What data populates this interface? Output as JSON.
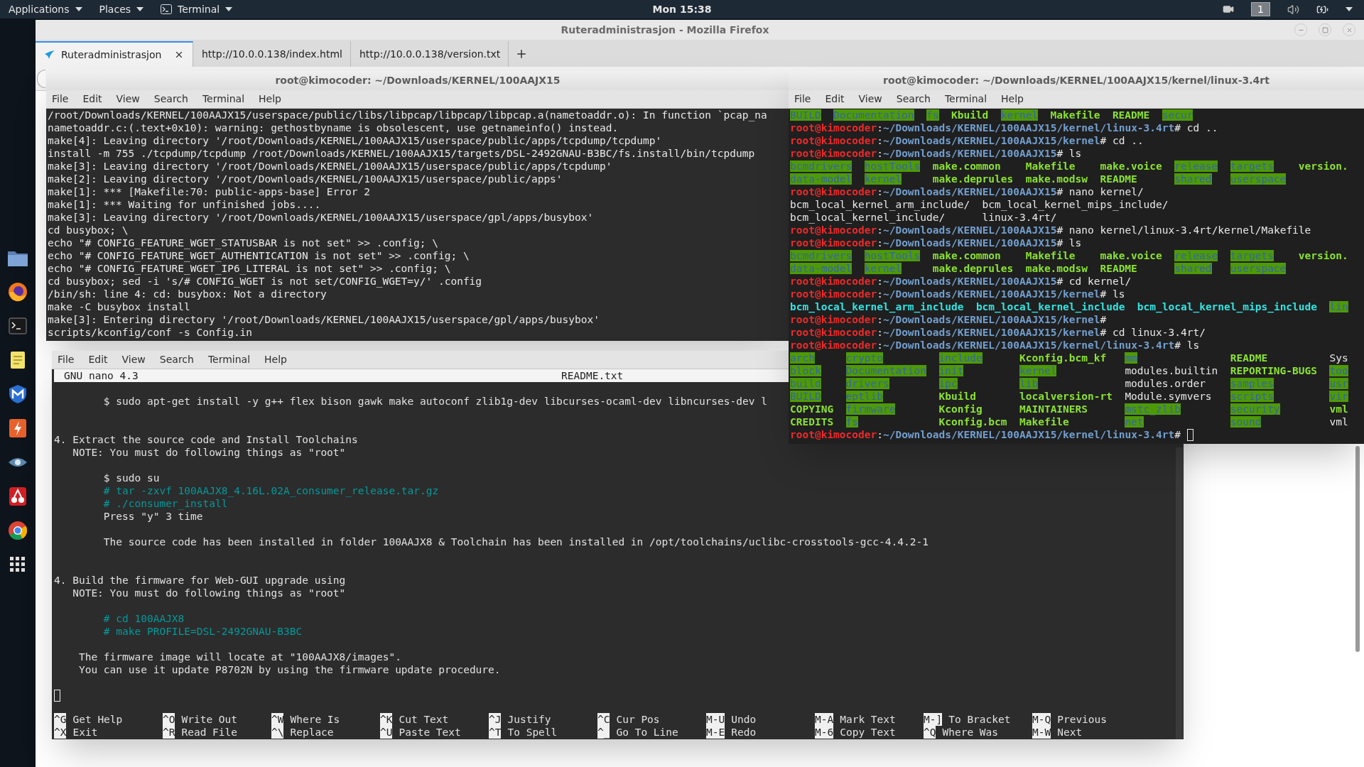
{
  "top_bar": {
    "menus": [
      {
        "label": "Applications",
        "kind": "menu"
      },
      {
        "label": "Places",
        "kind": "menu"
      },
      {
        "label": "Terminal",
        "kind": "app"
      }
    ],
    "clock": "Mon 15:38",
    "workspace": "1"
  },
  "browser": {
    "title": "Ruteradministrasjon - Mozilla Firefox",
    "tabs": [
      {
        "label": "Ruteradministrasjon",
        "selected": true
      },
      {
        "label": "http://10.0.0.138/index.html",
        "selected": false
      },
      {
        "label": "http://10.0.0.138/version.txt",
        "selected": false
      }
    ]
  },
  "terminal_left": {
    "title": "root@kimocoder: ~/Downloads/KERNEL/100AAJX15",
    "menu": [
      "File",
      "Edit",
      "View",
      "Search",
      "Terminal",
      "Help"
    ],
    "lines": [
      "/root/Downloads/KERNEL/100AAJX15/userspace/public/libs/libpcap/libpcap/libpcap.a(nametoaddr.o): In function `pcap_na",
      "nametoaddr.c:(.text+0x10): warning: gethostbyname is obsolescent, use getnameinfo() instead.",
      "make[4]: Leaving directory '/root/Downloads/KERNEL/100AAJX15/userspace/public/apps/tcpdump/tcpdump'",
      "install -m 755 ./tcpdump/tcpdump /root/Downloads/KERNEL/100AAJX15/targets/DSL-2492GNAU-B3BC/fs.install/bin/tcpdump",
      "make[3]: Leaving directory '/root/Downloads/KERNEL/100AAJX15/userspace/public/apps/tcpdump'",
      "make[2]: Leaving directory '/root/Downloads/KERNEL/100AAJX15/userspace/public/apps'",
      "make[1]: *** [Makefile:70: public-apps-base] Error 2",
      "make[1]: *** Waiting for unfinished jobs....",
      "make[3]: Leaving directory '/root/Downloads/KERNEL/100AAJX15/userspace/gpl/apps/busybox'",
      "cd busybox; \\",
      "echo \"# CONFIG_FEATURE_WGET_STATUSBAR is not set\" >> .config; \\",
      "echo \"# CONFIG_FEATURE_WGET_AUTHENTICATION is not set\" >> .config; \\",
      "echo \"# CONFIG_FEATURE_WGET_IP6_LITERAL is not set\" >> .config; \\",
      "cd busybox; sed -i 's/# CONFIG_WGET is not set/CONFIG_WGET=y/' .config",
      "/bin/sh: line 4: cd: busybox: Not a directory",
      "make -C busybox install",
      "make[3]: Entering directory '/root/Downloads/KERNEL/100AAJX15/userspace/gpl/apps/busybox'",
      "scripts/kconfig/conf -s Config.in"
    ]
  },
  "terminal_right": {
    "title": "root@kimocoder: ~/Downloads/KERNEL/100AAJX15/kernel/linux-3.4rt",
    "menu": [
      "File",
      "Edit",
      "View",
      "Search",
      "Terminal",
      "Help"
    ],
    "lines": [
      {
        "kind": "listing",
        "rows": [
          [
            {
              "name": "BUILD",
              "kind": "dir"
            },
            {
              "name": "Documentation",
              "kind": "dir"
            },
            {
              "name": "fs",
              "kind": "dir"
            },
            {
              "name": "Kbuild",
              "kind": "exec"
            },
            {
              "name": "kernel",
              "kind": "dir"
            },
            {
              "name": "Makefile",
              "kind": "exec"
            },
            {
              "name": "README",
              "kind": "exec"
            },
            {
              "name": "secur",
              "kind": "dir"
            }
          ]
        ]
      },
      {
        "kind": "prompt",
        "user": "root@kimocoder",
        "sep": ":",
        "path": "~/Downloads/KERNEL/100AAJX15/kernel/linux-3.4rt",
        "input": "# cd ..",
        "cursor": false
      },
      {
        "kind": "prompt",
        "user": "root@kimocoder",
        "sep": ":",
        "path": "~/Downloads/KERNEL/100AAJX15/kernel",
        "input": "# cd ..",
        "cursor": false
      },
      {
        "kind": "prompt",
        "user": "root@kimocoder",
        "sep": ":",
        "path": "~/Downloads/KERNEL/100AAJX15",
        "input": "# ls",
        "cursor": false
      },
      {
        "kind": "listing",
        "rows": [
          [
            {
              "name": "bcmdrivers",
              "kind": "dir"
            },
            {
              "name": "hostTools",
              "kind": "dir"
            },
            {
              "name": "make.common",
              "kind": "exec"
            },
            {
              "name": "Makefile",
              "kind": "exec"
            },
            {
              "name": "make.voice",
              "kind": "exec"
            },
            {
              "name": "release",
              "kind": "dir"
            },
            {
              "name": "targets",
              "kind": "dir"
            },
            {
              "name": "version.",
              "kind": "exec"
            }
          ],
          [
            {
              "name": "data-model",
              "kind": "dir"
            },
            {
              "name": "kernel",
              "kind": "dir"
            },
            {
              "name": "make.deprules",
              "kind": "exec"
            },
            {
              "name": "make.modsw",
              "kind": "exec"
            },
            {
              "name": "README",
              "kind": "exec"
            },
            {
              "name": "shared",
              "kind": "dir"
            },
            {
              "name": "userspace",
              "kind": "dir"
            }
          ]
        ]
      },
      {
        "kind": "prompt",
        "user": "root@kimocoder",
        "sep": ":",
        "path": "~/Downloads/KERNEL/100AAJX15",
        "input": "# nano kernel/",
        "cursor": false
      },
      {
        "kind": "listing",
        "rows": [
          [
            {
              "name": "bcm_local_kernel_arm_include/",
              "kind": "file"
            },
            {
              "name": "bcm_local_kernel_mips_include/",
              "kind": "file"
            }
          ],
          [
            {
              "name": "bcm_local_kernel_include/",
              "kind": "file"
            },
            {
              "name": "linux-3.4rt/",
              "kind": "file"
            }
          ]
        ]
      },
      {
        "kind": "prompt",
        "user": "root@kimocoder",
        "sep": ":",
        "path": "~/Downloads/KERNEL/100AAJX15",
        "input": "# nano kernel/linux-3.4rt/kernel/Makefile",
        "cursor": false
      },
      {
        "kind": "prompt",
        "user": "root@kimocoder",
        "sep": ":",
        "path": "~/Downloads/KERNEL/100AAJX15",
        "input": "# ls",
        "cursor": false
      },
      {
        "kind": "listing",
        "rows": [
          [
            {
              "name": "bcmdrivers",
              "kind": "dir"
            },
            {
              "name": "hostTools",
              "kind": "dir"
            },
            {
              "name": "make.common",
              "kind": "exec"
            },
            {
              "name": "Makefile",
              "kind": "exec"
            },
            {
              "name": "make.voice",
              "kind": "exec"
            },
            {
              "name": "release",
              "kind": "dir"
            },
            {
              "name": "targets",
              "kind": "dir"
            },
            {
              "name": "version.",
              "kind": "exec"
            }
          ],
          [
            {
              "name": "data-model",
              "kind": "dir"
            },
            {
              "name": "kernel",
              "kind": "dir"
            },
            {
              "name": "make.deprules",
              "kind": "exec"
            },
            {
              "name": "make.modsw",
              "kind": "exec"
            },
            {
              "name": "README",
              "kind": "exec"
            },
            {
              "name": "shared",
              "kind": "dir"
            },
            {
              "name": "userspace",
              "kind": "dir"
            }
          ]
        ]
      },
      {
        "kind": "prompt",
        "user": "root@kimocoder",
        "sep": ":",
        "path": "~/Downloads/KERNEL/100AAJX15",
        "input": "# cd kernel/",
        "cursor": false
      },
      {
        "kind": "prompt",
        "user": "root@kimocoder",
        "sep": ":",
        "path": "~/Downloads/KERNEL/100AAJX15/kernel",
        "input": "# ls",
        "cursor": false
      },
      {
        "kind": "listing",
        "rows": [
          [
            {
              "name": "bcm_local_kernel_arm_include",
              "kind": "link"
            },
            {
              "name": "bcm_local_kernel_include",
              "kind": "link"
            },
            {
              "name": "bcm_local_kernel_mips_include",
              "kind": "link"
            },
            {
              "name": "lin",
              "kind": "dir"
            }
          ]
        ]
      },
      {
        "kind": "prompt",
        "user": "root@kimocoder",
        "sep": ":",
        "path": "~/Downloads/KERNEL/100AAJX15/kernel",
        "input": "#",
        "cursor": false
      },
      {
        "kind": "prompt",
        "user": "root@kimocoder",
        "sep": ":",
        "path": "~/Downloads/KERNEL/100AAJX15/kernel",
        "input": "# cd linux-3.4rt/",
        "cursor": false
      },
      {
        "kind": "prompt",
        "user": "root@kimocoder",
        "sep": ":",
        "path": "~/Downloads/KERNEL/100AAJX15/kernel/linux-3.4rt",
        "input": "# ls",
        "cursor": false
      },
      {
        "kind": "listing",
        "rows": [
          [
            {
              "name": "arch",
              "kind": "dir"
            },
            {
              "name": "crypto",
              "kind": "dir"
            },
            {
              "name": "include",
              "kind": "dir"
            },
            {
              "name": "Kconfig.bcm_kf",
              "kind": "exec"
            },
            {
              "name": "mm",
              "kind": "dir"
            },
            {
              "name": "README",
              "kind": "exec"
            },
            {
              "name": "Sys",
              "kind": "file"
            }
          ],
          [
            {
              "name": "block",
              "kind": "dir"
            },
            {
              "name": "Documentation",
              "kind": "dir"
            },
            {
              "name": "init",
              "kind": "dir"
            },
            {
              "name": "kernel",
              "kind": "dir"
            },
            {
              "name": "modules.builtin",
              "kind": "file"
            },
            {
              "name": "REPORTING-BUGS",
              "kind": "exec"
            },
            {
              "name": "too",
              "kind": "dir"
            }
          ],
          [
            {
              "name": "build",
              "kind": "dir"
            },
            {
              "name": "drivers",
              "kind": "dir"
            },
            {
              "name": "ipc",
              "kind": "dir"
            },
            {
              "name": "lib",
              "kind": "dir"
            },
            {
              "name": "modules.order",
              "kind": "file"
            },
            {
              "name": "samples",
              "kind": "dir"
            },
            {
              "name": "usr",
              "kind": "dir"
            }
          ],
          [
            {
              "name": "BUILD",
              "kind": "dir"
            },
            {
              "name": "eptlib",
              "kind": "dir"
            },
            {
              "name": "Kbuild",
              "kind": "exec"
            },
            {
              "name": "localversion-rt",
              "kind": "exec"
            },
            {
              "name": "Module.symvers",
              "kind": "file"
            },
            {
              "name": "scripts",
              "kind": "dir"
            },
            {
              "name": "vir",
              "kind": "dir"
            }
          ],
          [
            {
              "name": "COPYING",
              "kind": "exec"
            },
            {
              "name": "firmware",
              "kind": "dir"
            },
            {
              "name": "Kconfig",
              "kind": "exec"
            },
            {
              "name": "MAINTAINERS",
              "kind": "exec"
            },
            {
              "name": "mstc_zlib",
              "kind": "dir"
            },
            {
              "name": "security",
              "kind": "dir"
            },
            {
              "name": "vml",
              "kind": "exec"
            }
          ],
          [
            {
              "name": "CREDITS",
              "kind": "exec"
            },
            {
              "name": "fs",
              "kind": "dir"
            },
            {
              "name": "Kconfig.bcm",
              "kind": "exec"
            },
            {
              "name": "Makefile",
              "kind": "exec"
            },
            {
              "name": "net",
              "kind": "dir"
            },
            {
              "name": "sound",
              "kind": "dir"
            },
            {
              "name": "vml",
              "kind": "file"
            }
          ]
        ]
      },
      {
        "kind": "prompt",
        "user": "root@kimocoder",
        "sep": ":",
        "path": "~/Downloads/KERNEL/100AAJX15/kernel/linux-3.4rt",
        "input": "# ",
        "cursor": true
      }
    ]
  },
  "nano": {
    "menu": [
      "File",
      "Edit",
      "View",
      "Search",
      "Terminal",
      "Help"
    ],
    "version": "GNU nano 4.3",
    "file": "README.txt",
    "lines": [
      {
        "kind": "blank"
      },
      {
        "kind": "text",
        "text": "        $ sudo apt-get install -y g++ flex bison gawk make autoconf zlib1g-dev libcurses-ocaml-dev libncurses-dev l"
      },
      {
        "kind": "blank"
      },
      {
        "kind": "blank"
      },
      {
        "kind": "text",
        "text": "4. Extract the source code and Install Toolchains"
      },
      {
        "kind": "text",
        "text": "   NOTE: You must do following things as \"root\""
      },
      {
        "kind": "blank"
      },
      {
        "kind": "text",
        "text": "        $ sudo su"
      },
      {
        "kind": "comment",
        "text": "        # tar -zxvf 100AAJX8_4.16L.02A_consumer_release.tar.gz"
      },
      {
        "kind": "comment",
        "text": "        # ./consumer_install"
      },
      {
        "kind": "text",
        "text": "        Press \"y\" 3 time"
      },
      {
        "kind": "blank"
      },
      {
        "kind": "text",
        "text": "        The source code has been installed in folder 100AAJX8 & Toolchain has been installed in /opt/toolchains/uclibc-crosstools-gcc-4.4.2-1"
      },
      {
        "kind": "blank"
      },
      {
        "kind": "blank"
      },
      {
        "kind": "text",
        "text": "4. Build the firmware for Web-GUI upgrade using"
      },
      {
        "kind": "text",
        "text": "   NOTE: You must do following things as \"root\""
      },
      {
        "kind": "blank"
      },
      {
        "kind": "comment",
        "text": "        # cd 100AAJX8"
      },
      {
        "kind": "comment",
        "text": "        # make PROFILE=DSL-2492GNAU-B3BC"
      },
      {
        "kind": "blank"
      },
      {
        "kind": "text",
        "text": "    The firmware image will locate at \"100AAJX8/images\"."
      },
      {
        "kind": "text",
        "text": "    You can use it update P8702N by using the firmware update procedure."
      },
      {
        "kind": "blank"
      },
      {
        "kind": "cursor"
      }
    ],
    "shortcuts": [
      [
        {
          "key": "^G",
          "label": "Get Help"
        },
        {
          "key": "^O",
          "label": "Write Out"
        },
        {
          "key": "^W",
          "label": "Where Is"
        },
        {
          "key": "^K",
          "label": "Cut Text"
        },
        {
          "key": "^J",
          "label": "Justify"
        },
        {
          "key": "^C",
          "label": "Cur Pos"
        },
        {
          "key": "M-U",
          "label": "Undo"
        },
        {
          "key": "M-A",
          "label": "Mark Text"
        },
        {
          "key": "M-]",
          "label": "To Bracket"
        },
        {
          "key": "M-Q",
          "label": "Previous"
        }
      ],
      [
        {
          "key": "^X",
          "label": "Exit"
        },
        {
          "key": "^R",
          "label": "Read File"
        },
        {
          "key": "^\\",
          "label": "Replace"
        },
        {
          "key": "^U",
          "label": "Paste Text"
        },
        {
          "key": "^T",
          "label": "To Spell"
        },
        {
          "key": "^_",
          "label": "Go To Line"
        },
        {
          "key": "M-E",
          "label": "Redo"
        },
        {
          "key": "M-6",
          "label": "Copy Text"
        },
        {
          "key": "^Q",
          "label": "Where Was"
        },
        {
          "key": "M-W",
          "label": "Next"
        }
      ]
    ]
  }
}
